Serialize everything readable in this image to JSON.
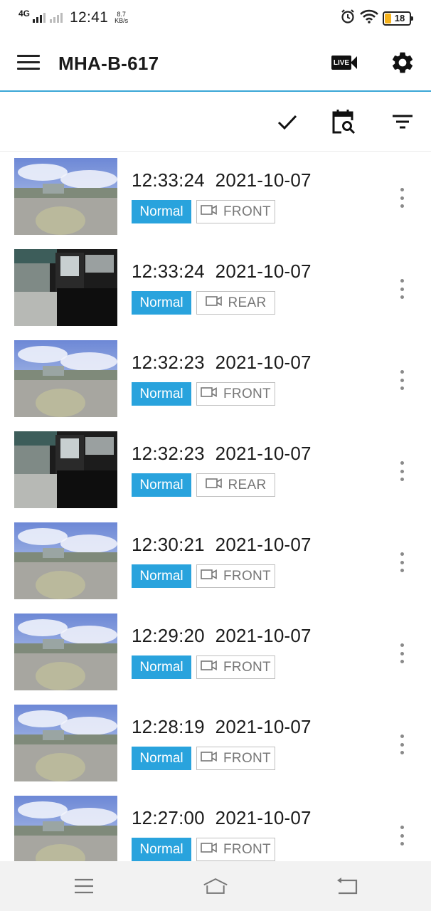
{
  "status_bar": {
    "network": "4G",
    "time": "12:41",
    "speed_value": "8.7",
    "speed_unit": "KB/s",
    "battery_level": "18",
    "icons": [
      "signal-icon",
      "alarm-icon",
      "wifi-icon",
      "battery-icon"
    ]
  },
  "app_bar": {
    "title": "MHA-B-617",
    "live_label": "LIVE",
    "icons": [
      "menu-icon",
      "live-camera-icon",
      "settings-gear-icon"
    ]
  },
  "toolbar": {
    "icons": [
      "checkmark-icon",
      "calendar-search-icon",
      "filter-icon"
    ]
  },
  "recordings": [
    {
      "time": "12:33:24",
      "date": "2021-10-07",
      "type": "Normal",
      "camera": "FRONT",
      "thumb": "front"
    },
    {
      "time": "12:33:24",
      "date": "2021-10-07",
      "type": "Normal",
      "camera": "REAR",
      "thumb": "rear"
    },
    {
      "time": "12:32:23",
      "date": "2021-10-07",
      "type": "Normal",
      "camera": "FRONT",
      "thumb": "front"
    },
    {
      "time": "12:32:23",
      "date": "2021-10-07",
      "type": "Normal",
      "camera": "REAR",
      "thumb": "rear"
    },
    {
      "time": "12:30:21",
      "date": "2021-10-07",
      "type": "Normal",
      "camera": "FRONT",
      "thumb": "front"
    },
    {
      "time": "12:29:20",
      "date": "2021-10-07",
      "type": "Normal",
      "camera": "FRONT",
      "thumb": "front"
    },
    {
      "time": "12:28:19",
      "date": "2021-10-07",
      "type": "Normal",
      "camera": "FRONT",
      "thumb": "front"
    },
    {
      "time": "12:27:00",
      "date": "2021-10-07",
      "type": "Normal",
      "camera": "FRONT",
      "thumb": "front"
    }
  ],
  "nav_bar": {
    "icons": [
      "recents-icon",
      "home-icon",
      "back-icon"
    ]
  },
  "colors": {
    "accent": "#29a3dd",
    "app_bar_divider": "#3aa6d6",
    "nav_bar_bg": "#f2f2f2"
  }
}
